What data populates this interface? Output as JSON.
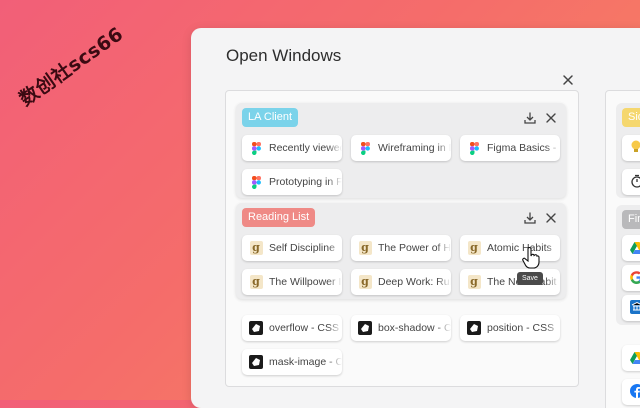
{
  "watermark": "数创社scs66",
  "panel": {
    "title": "Open Windows"
  },
  "groups": [
    {
      "title": "LA Client",
      "color": "#7bd3ea",
      "tabs": [
        {
          "label": "Recently viewed",
          "icon": "figma-icon"
        },
        {
          "label": "Wireframing in Figma",
          "icon": "figma-icon"
        },
        {
          "label": "Figma Basics - ",
          "icon": "figma-icon"
        },
        {
          "label": "Prototyping in Figma",
          "icon": "figma-icon"
        }
      ]
    },
    {
      "title": "Reading List",
      "color": "#ef8a86",
      "tabs": [
        {
          "label": "Self Discipline",
          "icon": "goodreads-icon"
        },
        {
          "label": "The Power of Habit",
          "icon": "goodreads-icon"
        },
        {
          "label": "Atomic Habits",
          "icon": "goodreads-icon"
        },
        {
          "label": "The Willpower Instinct",
          "icon": "goodreads-icon"
        },
        {
          "label": "Deep Work: Rules",
          "icon": "goodreads-icon"
        },
        {
          "label": "The Now Habit",
          "icon": "goodreads-icon"
        }
      ]
    }
  ],
  "ungrouped_tabs": [
    {
      "label": "overflow - CSS",
      "icon": "mdn-icon"
    },
    {
      "label": "box-shadow - CSS",
      "icon": "mdn-icon"
    },
    {
      "label": "position - CSS",
      "icon": "mdn-icon"
    },
    {
      "label": "mask-image - CSS",
      "icon": "mdn-icon"
    }
  ],
  "right_column": {
    "groups": [
      {
        "title": "Sid",
        "color": "#f5d76e",
        "icons": [
          "lightbulb-icon",
          "stopwatch-icon"
        ]
      },
      {
        "title": "Fin",
        "color": "#b9b9bb",
        "icons": [
          "google-drive-icon",
          "google-icon",
          "bank-icon"
        ]
      }
    ],
    "tabs": [
      "google-drive-icon",
      "facebook-icon"
    ]
  },
  "tooltip": {
    "text": "Save"
  }
}
